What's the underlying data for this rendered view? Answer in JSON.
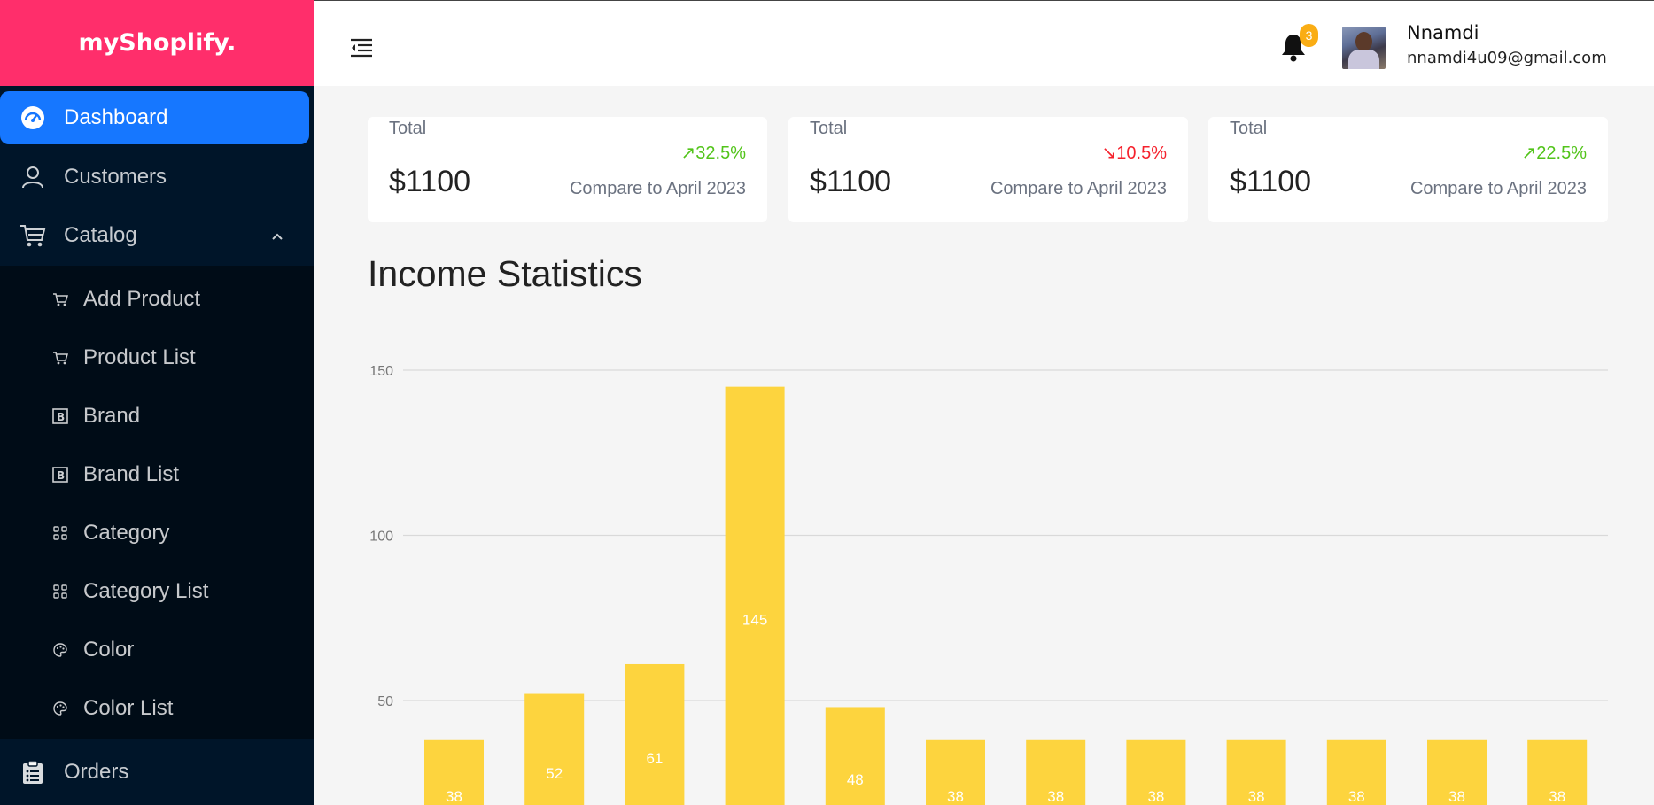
{
  "app": {
    "brand": "myShoplify."
  },
  "sidebar": {
    "items": [
      {
        "label": "Dashboard",
        "icon": "dashboard-icon",
        "active": true
      },
      {
        "label": "Customers",
        "icon": "user-icon"
      },
      {
        "label": "Catalog",
        "icon": "cart-icon",
        "expanded": true
      }
    ],
    "catalog_sub": [
      {
        "label": "Add Product",
        "icon": "cart-icon"
      },
      {
        "label": "Product List",
        "icon": "cart-icon"
      },
      {
        "label": "Brand",
        "icon": "brand-icon"
      },
      {
        "label": "Brand List",
        "icon": "brand-icon"
      },
      {
        "label": "Category",
        "icon": "category-icon"
      },
      {
        "label": "Category List",
        "icon": "category-icon"
      },
      {
        "label": "Color",
        "icon": "palette-icon"
      },
      {
        "label": "Color List",
        "icon": "palette-icon"
      }
    ],
    "orders": {
      "label": "Orders",
      "icon": "clipboard-icon"
    }
  },
  "header": {
    "notification_count": "3",
    "user_name": "Nnamdi",
    "user_email": "nnamdi4u09@gmail.com"
  },
  "cards": [
    {
      "label": "Total",
      "amount": "$1100",
      "change": "↗32.5%",
      "trend": "up",
      "compare": "Compare to April 2023"
    },
    {
      "label": "Total",
      "amount": "$1100",
      "change": "↘10.5%",
      "trend": "down",
      "compare": "Compare to April 2023"
    },
    {
      "label": "Total",
      "amount": "$1100",
      "change": "↗22.5%",
      "trend": "up",
      "compare": "Compare to April 2023"
    }
  ],
  "income_section": {
    "title": "Income Statistics"
  },
  "colors": {
    "bar": "#fdd43e",
    "sidebar": "#001529",
    "brand": "#ff2e6b",
    "active": "#1677ff"
  },
  "chart_data": {
    "type": "bar",
    "title": "",
    "xlabel": "",
    "ylabel": "",
    "ylim": [
      0,
      150
    ],
    "yticks": [
      150,
      100,
      50
    ],
    "grid": true,
    "values": [
      38,
      52,
      61,
      145,
      48,
      38,
      38,
      38,
      38,
      38,
      38,
      38
    ]
  }
}
